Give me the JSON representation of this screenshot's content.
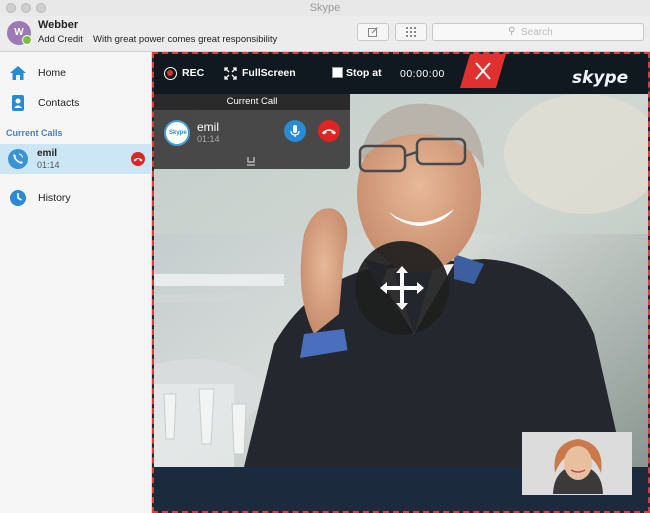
{
  "window": {
    "title": "Skype"
  },
  "profile": {
    "avatar_initial": "W",
    "name": "Webber",
    "credit_link": "Add Credit",
    "mood": "With great power comes great responsibility"
  },
  "header_buttons": {
    "compose_icon": "compose-icon",
    "dialpad_icon": "dialpad-icon"
  },
  "search": {
    "placeholder": "Search"
  },
  "sidebar": {
    "items": [
      {
        "label": "Home",
        "icon": "home-icon"
      },
      {
        "label": "Contacts",
        "icon": "contacts-icon"
      }
    ],
    "section_label": "Current Calls",
    "current_call": {
      "name": "emil",
      "time": "01:14"
    },
    "history": {
      "label": "History",
      "icon": "clock-icon"
    }
  },
  "recorder": {
    "rec_label": "REC",
    "fullscreen_label": "FullScreen",
    "stop_at_label": "Stop at",
    "stop_at_checked": false,
    "timer": "00:00:00",
    "logo": "skype"
  },
  "call_panel": {
    "title": "Current Call",
    "contact_name": "emil",
    "duration": "01:14",
    "avatar_text": "Skype"
  },
  "colors": {
    "accent_blue": "#2a8ad4",
    "hangup_red": "#e02424",
    "selection_blue": "#cde6f5",
    "section_blue": "#4a7fbf",
    "record_border": "#e03a3a"
  }
}
